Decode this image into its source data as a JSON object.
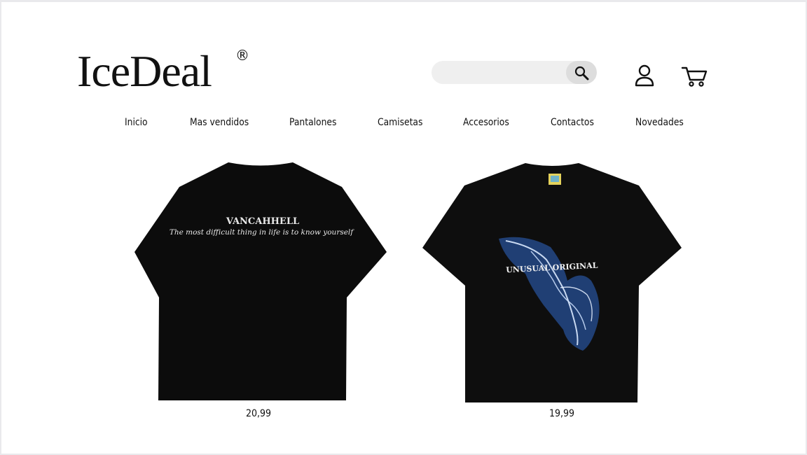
{
  "brand": {
    "name": "IceDeal",
    "registered": "®"
  },
  "search": {
    "placeholder": "",
    "value": "",
    "icon": "search-icon"
  },
  "header_icons": {
    "account": "user-icon",
    "cart": "cart-icon"
  },
  "nav": {
    "items": [
      {
        "label": "Inicio"
      },
      {
        "label": "Mas vendidos"
      },
      {
        "label": "Pantalones"
      },
      {
        "label": "Camisetas"
      },
      {
        "label": "Accesorios"
      },
      {
        "label": "Contactos"
      },
      {
        "label": "Novedades"
      }
    ]
  },
  "products": [
    {
      "price": "20,99",
      "print_title": "VANCAHHELL",
      "print_tagline": "The most difficult thing in life is to know yourself"
    },
    {
      "price": "19,99",
      "print_title": "UNUSUAL ORIGINAL"
    }
  ],
  "colors": {
    "background": "#ffffff",
    "search_bg": "#efefef",
    "search_btn": "#dddddd",
    "text": "#111111"
  }
}
